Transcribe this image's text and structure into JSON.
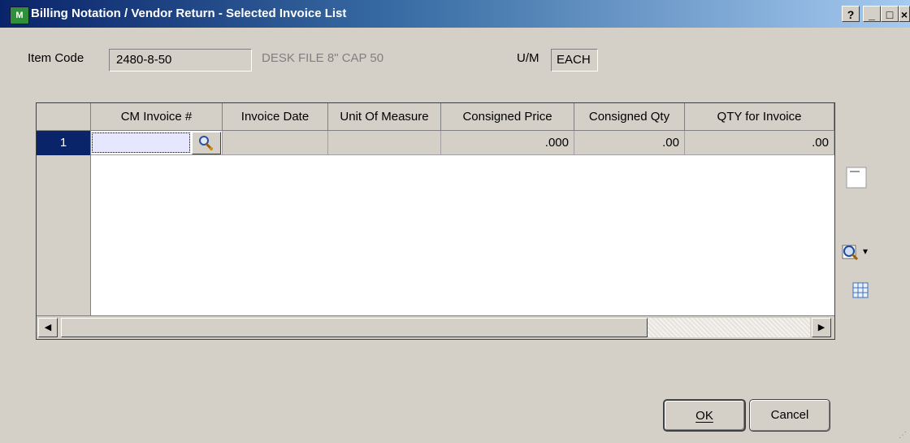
{
  "window": {
    "title": "Billing Notation / Vendor Return - Selected Invoice List",
    "app_icon_text": "M",
    "help_glyph": "?",
    "minimize_glyph": "_",
    "maximize_glyph": "□",
    "close_glyph": "×"
  },
  "item": {
    "label": "Item Code",
    "value": "2480-8-50",
    "description": "DESK FILE 8\" CAP 50",
    "um_label": "U/M",
    "um_value": "EACH"
  },
  "grid": {
    "columns": [
      "CM Invoice #",
      "Invoice Date",
      "Unit Of Measure",
      "Consigned Price",
      "Consigned Qty",
      "QTY for Invoice"
    ],
    "rows": [
      {
        "num": "1",
        "cm_invoice": "",
        "invoice_date": "",
        "unit_of_measure": "",
        "consigned_price": ".000",
        "consigned_qty": ".00",
        "qty_for_invoice": ".00"
      }
    ],
    "scroll_left_glyph": "◀",
    "scroll_right_glyph": "▶"
  },
  "side_icons": [
    "note-icon",
    "zoom-lookup-icon",
    "grid-settings-icon"
  ],
  "side_dropdown_glyph": "▾",
  "buttons": {
    "ok": "OK",
    "cancel": "Cancel"
  }
}
